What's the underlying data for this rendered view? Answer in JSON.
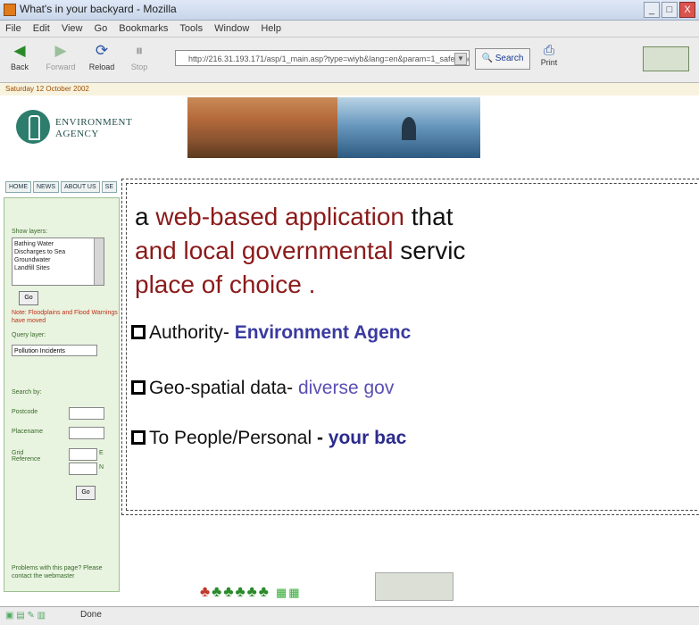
{
  "window": {
    "title": "What's in your backyard - Mozilla",
    "controls": [
      "_",
      "□",
      "X"
    ]
  },
  "menu": [
    "File",
    "Edit",
    "View",
    "Go",
    "Bookmarks",
    "Tools",
    "Window",
    "Help"
  ],
  "toolbar": {
    "back": "Back",
    "forward": "Forward",
    "reload": "Reload",
    "stop": "Stop",
    "url": "http://216.31.193.171/asp/1_main.asp?type=wiyb&lang=en&param=1_safecond=on",
    "search": "Search",
    "print": "Print"
  },
  "page": {
    "date": "Saturday 12 October 2002",
    "logo_line1": "ENVIRONMENT",
    "logo_line2": "AGENCY",
    "nav_tabs": [
      "HOME",
      "NEWS",
      "ABOUT US",
      "SE"
    ],
    "show_layers_label": "Show layers:",
    "layers": [
      "Bathing Water",
      "Discharges to Sea",
      "Groundwater",
      "Landfill Sites"
    ],
    "go": "Go",
    "note": "Note: Floodplains and Flood Warnings have moved",
    "query_layer_label": "Query layer:",
    "query_layer_value": "Pollution Incidents",
    "search_by_label": "Search by:",
    "postcode_label": "Postcode",
    "placename_label": "Placename",
    "grid_label": "Grid Reference",
    "e": "E",
    "n": "N",
    "problems_text": "Problems with this page? Please contact the webmaster"
  },
  "status": {
    "text": "Done"
  },
  "callout": {
    "line1_part1": "a ",
    "line1_part2": "web-based application",
    "line1_part3": " that",
    "line2_part1": "and local governmental",
    "line2_part2": " servic",
    "line3": "place of choice .",
    "bullet1_label": "Authority- ",
    "bullet1_value": "Environment Agenc",
    "bullet2_label": "Geo-spatial data- ",
    "bullet2_value": "diverse gov",
    "bullet3_label": "To People/Personal ",
    "bullet3_dash": "- ",
    "bullet3_value": "your bac"
  },
  "colors": {
    "dark_red": "#8b1a1a",
    "blue": "#3a3aa0",
    "light_blue": "#5a4fb3",
    "panel_green": "#e8f3e0"
  }
}
